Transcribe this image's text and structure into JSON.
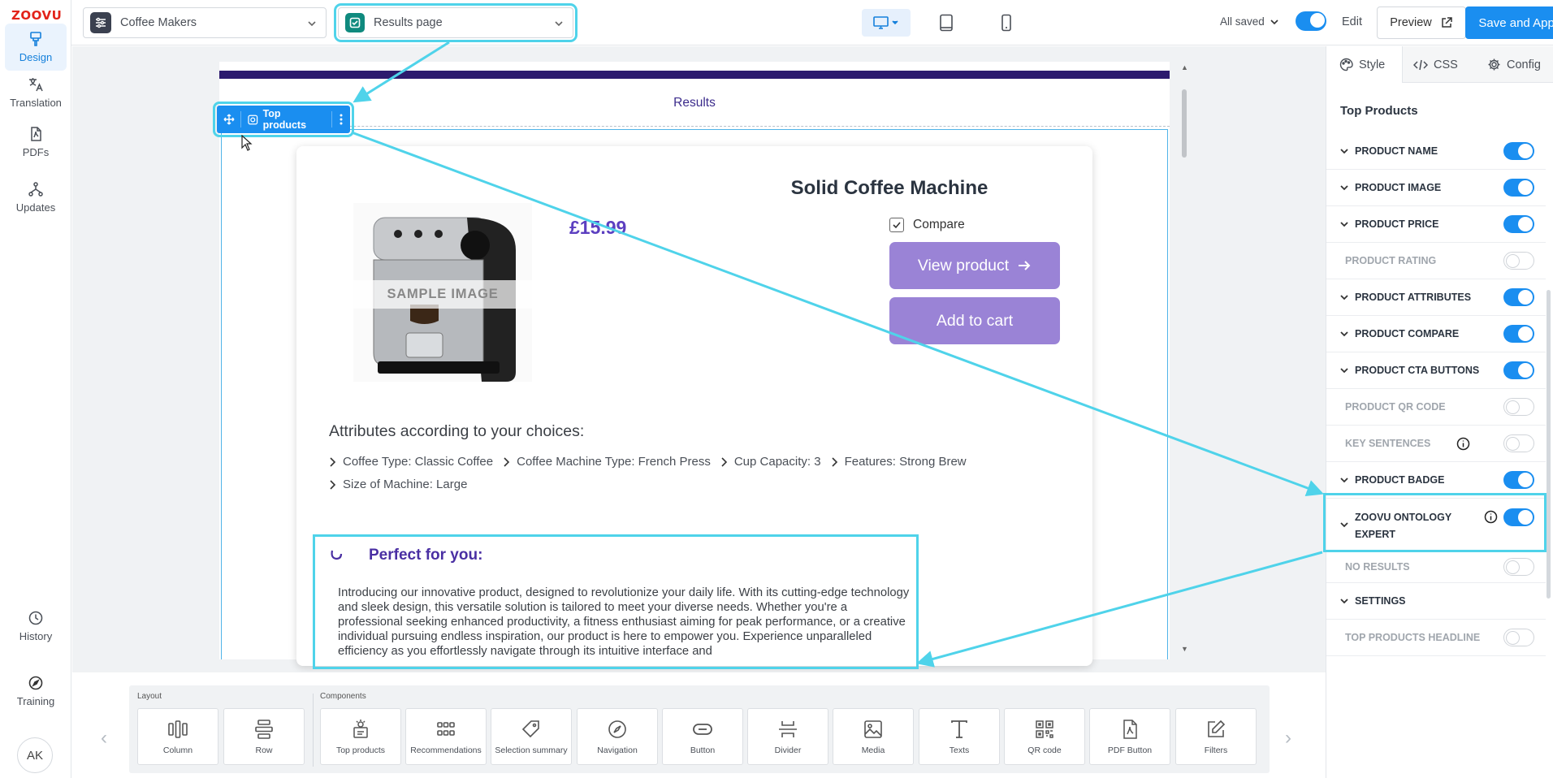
{
  "app": {
    "logo": "ZOOVU"
  },
  "rail": {
    "items": [
      {
        "label": "Design",
        "icon": "brush-icon"
      },
      {
        "label": "Translation",
        "icon": "translate-icon"
      },
      {
        "label": "PDFs",
        "icon": "pdf-icon"
      },
      {
        "label": "Updates",
        "icon": "updates-icon"
      }
    ],
    "bottom_items": [
      {
        "label": "History",
        "icon": "history-icon"
      },
      {
        "label": "Training",
        "icon": "compass-icon"
      }
    ],
    "avatar": "AK"
  },
  "topbar": {
    "project_select": "Coffee Makers",
    "page_select": "Results page",
    "devices": [
      "desktop",
      "tablet",
      "mobile"
    ],
    "active_device": "desktop",
    "save_status": "All saved",
    "edit_label": "Edit",
    "edit_on": true,
    "preview_label": "Preview",
    "save_label": "Save and Apply"
  },
  "canvas": {
    "results_heading": "Results",
    "block_chip_label": "Top products",
    "product": {
      "name": "Solid Coffee Machine",
      "price": "£15.99",
      "image_label": "SAMPLE IMAGE",
      "compare_label": "Compare",
      "compare_checked": true,
      "view_button": "View product",
      "cart_button": "Add to cart"
    },
    "attributes_title": "Attributes according to your choices:",
    "attributes": [
      "Coffee Type: Classic Coffee",
      "Coffee Machine Type: French Press",
      "Cup Capacity: 3",
      "Features: Strong Brew",
      "Size of Machine: Large"
    ],
    "perfect_title": "Perfect for you:",
    "perfect_text": "Introducing our innovative product, designed to revolutionize your daily life. With its cutting-edge technology and sleek design, this versatile solution is tailored to meet your diverse needs. Whether you're a professional seeking enhanced productivity, a fitness enthusiast aiming for peak performance, or a creative individual pursuing endless inspiration, our product is here to empower you. Experience unparalleled efficiency as you effortlessly navigate through its intuitive interface and"
  },
  "bottom": {
    "layout_label": "Layout",
    "components_label": "Components",
    "layout": [
      {
        "label": "Column",
        "icon": "column-icon"
      },
      {
        "label": "Row",
        "icon": "row-icon"
      }
    ],
    "components": [
      {
        "label": "Top products",
        "icon": "top-products-icon"
      },
      {
        "label": "Recommendations",
        "icon": "grid-icon"
      },
      {
        "label": "Selection summary",
        "icon": "tag-icon"
      },
      {
        "label": "Navigation",
        "icon": "compass-icon"
      },
      {
        "label": "Button",
        "icon": "button-icon"
      },
      {
        "label": "Divider",
        "icon": "divider-icon"
      },
      {
        "label": "Media",
        "icon": "image-icon"
      },
      {
        "label": "Texts",
        "icon": "text-icon"
      },
      {
        "label": "QR code",
        "icon": "qr-icon"
      },
      {
        "label": "PDF Button",
        "icon": "pdf-icon"
      },
      {
        "label": "Filters",
        "icon": "edit-icon"
      }
    ]
  },
  "panel": {
    "tabs": [
      {
        "label": "Style",
        "icon": "palette-icon"
      },
      {
        "label": "CSS",
        "icon": "code-icon"
      },
      {
        "label": "Config",
        "icon": "gear-icon"
      }
    ],
    "active_tab": "Style",
    "title": "Top Products",
    "rows": [
      {
        "label": "Product name",
        "on": true,
        "expandable": true
      },
      {
        "label": "Product image",
        "on": true,
        "expandable": true
      },
      {
        "label": "Product price",
        "on": true,
        "expandable": true
      },
      {
        "label": "Product rating",
        "on": false,
        "expandable": false
      },
      {
        "label": "Product attributes",
        "on": true,
        "expandable": true
      },
      {
        "label": "Product compare",
        "on": true,
        "expandable": true
      },
      {
        "label": "Product CTA buttons",
        "on": true,
        "expandable": true
      },
      {
        "label": "Product QR code",
        "on": false,
        "expandable": false
      },
      {
        "label": "Key sentences",
        "on": false,
        "expandable": false,
        "info": true
      },
      {
        "label": "Product badge",
        "on": true,
        "expandable": true
      },
      {
        "label": "Zoovu Ontology Expert",
        "on": true,
        "expandable": true,
        "info": true
      },
      {
        "label": "No results",
        "on": false,
        "expandable": false
      },
      {
        "label": "Settings",
        "on": null,
        "expandable": true
      },
      {
        "label": "Top products headline",
        "on": false,
        "expandable": false
      }
    ]
  },
  "colors": {
    "accent": "#1a8ef0",
    "cta": "#9a83d6",
    "highlight": "#4fd3ea",
    "logo": "#e2231a",
    "price": "#5c3fc0",
    "brand_band": "#2c1a6e"
  }
}
